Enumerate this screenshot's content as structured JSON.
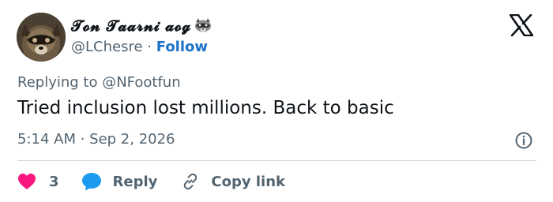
{
  "author": {
    "display_name": "𝓣𝓸𝓷 𝓣𝓪𝓪𝓻𝓷𝓲 𝓪𝓸𝓰",
    "handle": "@LChesre",
    "separator": "·",
    "follow_label": "Follow",
    "name_emoji": "raccoon-icon"
  },
  "reply_to": "Replying to @NFootfun",
  "tweet": {
    "text": "Tried inclusion lost millions. Back to basic",
    "timestamp": "5:14 AM · Sep 2, 2026"
  },
  "actions": {
    "like_count": "3",
    "reply_label": "Reply",
    "copy_label": "Copy link"
  },
  "colors": {
    "like": "#f91880",
    "reply": "#1d9bf0",
    "link": "#1d73c9",
    "secondary_text": "#536471"
  }
}
